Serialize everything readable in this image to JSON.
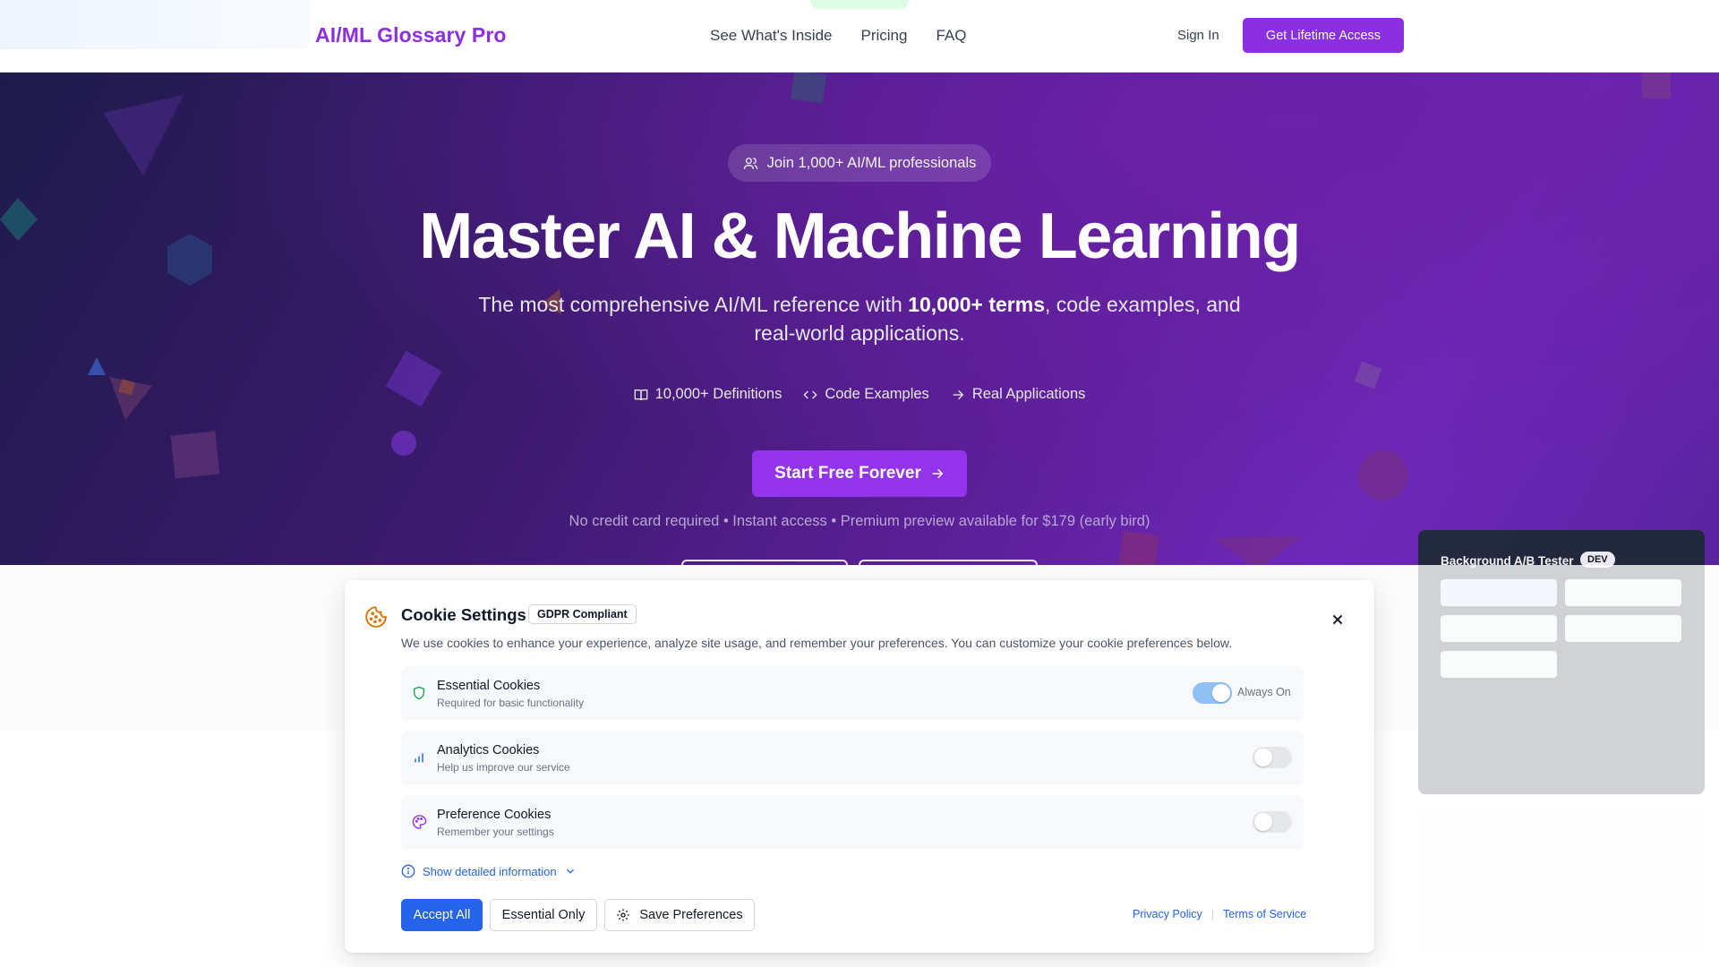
{
  "header": {
    "brand": "AI/ML Glossary Pro",
    "nav": [
      "See What's Inside",
      "Pricing",
      "FAQ"
    ],
    "sign_in": "Sign In",
    "cta": "Get Lifetime Access"
  },
  "hero": {
    "pill": "Join 1,000+ AI/ML professionals",
    "headline": "Master AI & Machine Learning",
    "sub_before": "The most comprehensive AI/ML reference with ",
    "sub_bold": "10,000+ terms",
    "sub_after": ", code examples, and real-world applications.",
    "features": [
      {
        "icon": "book-icon",
        "label": "10,000+ Definitions"
      },
      {
        "icon": "code-icon",
        "label": "Code Examples"
      },
      {
        "icon": "arrow-right-icon",
        "label": "Real Applications"
      }
    ],
    "cta": "Start Free Forever",
    "note": "No credit card required • Instant access • Premium preview available for $179 (early bird)"
  },
  "dev_panel": {
    "title": "Background A/B Tester",
    "badge": "DEV"
  },
  "cookie": {
    "title": "Cookie Settings",
    "badge": "GDPR Compliant",
    "description": "We use cookies to enhance your experience, analyze site usage, and remember your preferences. You can customize your cookie preferences below.",
    "categories": [
      {
        "name": "Essential Cookies",
        "desc": "Required for basic functionality",
        "icon": "shield-icon",
        "enabled": true,
        "status": "Always On"
      },
      {
        "name": "Analytics Cookies",
        "desc": "Help us improve our service",
        "icon": "bar-chart-icon",
        "enabled": false
      },
      {
        "name": "Preference Cookies",
        "desc": "Remember your settings",
        "icon": "palette-icon",
        "enabled": false
      }
    ],
    "details_toggle": "Show detailed information",
    "buttons": {
      "accept_all": "Accept All",
      "essential_only": "Essential Only",
      "save": "Save Preferences"
    },
    "links": [
      "Privacy Policy",
      "Terms of Service"
    ]
  },
  "colors": {
    "brand": "#8b2fe0",
    "primary_blue": "#2563eb",
    "hero_dark": "#1e1b4b",
    "hero_purple": "#6d28b9"
  }
}
